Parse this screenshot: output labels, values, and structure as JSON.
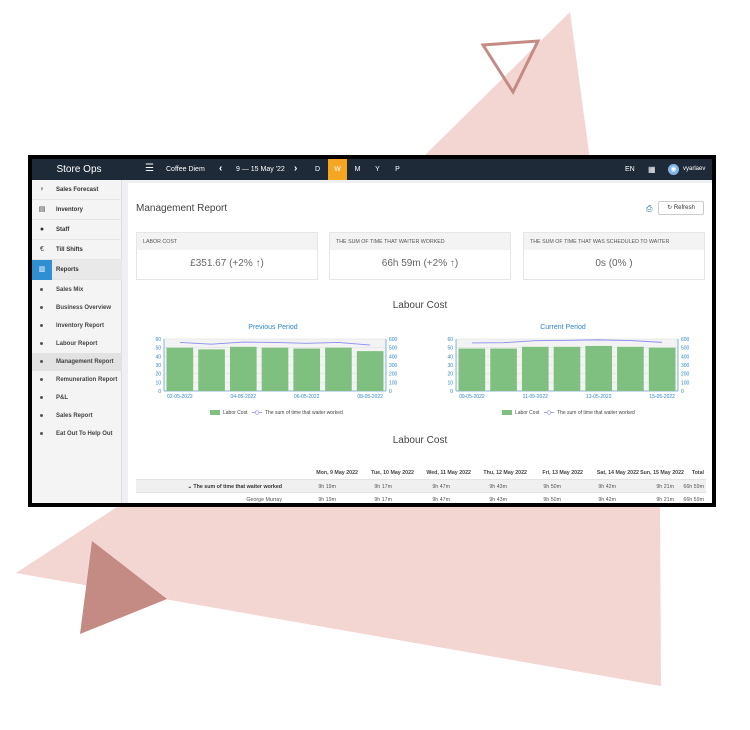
{
  "colors": {
    "triangle_light": "#f3d5d2",
    "triangle_dark": "#c48a84",
    "topbar": "#1f2a38",
    "accent": "#f5a623",
    "bar_green": "#7fbf7f",
    "line_purple": "#8c8cf0",
    "link_blue": "#2f86c9"
  },
  "topbar": {
    "brand": "Store Ops",
    "store": "Coffee Diem",
    "period": "9 — 15 May '22",
    "tabs": [
      "D",
      "W",
      "M",
      "Y",
      "P"
    ],
    "active_tab": "W",
    "language": "EN",
    "username": "vyarlaev"
  },
  "sidebar": {
    "items": [
      {
        "label": "Sales Forecast",
        "icon": "bulb-icon"
      },
      {
        "label": "Inventory",
        "icon": "box-icon"
      },
      {
        "label": "Staff",
        "icon": "person-icon"
      },
      {
        "label": "Till Shifts",
        "icon": "euro-icon"
      },
      {
        "label": "Reports",
        "icon": "bar-chart-icon",
        "active": true
      }
    ],
    "sub_items": [
      "Sales Mix",
      "Business Overview",
      "Inventory Report",
      "Labour Report",
      "Management Report",
      "Remuneration Report",
      "P&L",
      "Sales Report",
      "Eat Out To Help Out"
    ],
    "active_sub": "Management Report"
  },
  "content": {
    "title": "Management Report",
    "refresh_label": "Refresh",
    "stats": [
      {
        "label": "LABOR COST",
        "value": "£351.67 (+2% ↑)"
      },
      {
        "label": "THE SUM OF TIME THAT WAITER WORKED",
        "value": "66h 59m (+2% ↑)"
      },
      {
        "label": "THE SUM OF TIME THAT WAS SCHEDULED TO WAITER",
        "value": "0s (0% )"
      }
    ],
    "section1_title": "Labour Cost",
    "section2_title": "Labour Cost"
  },
  "chart_data": [
    {
      "type": "bar",
      "title": "Previous Period",
      "categories": [
        "02-05-2022",
        "03-05-2022",
        "04-05-2022",
        "05-05-2022",
        "06-05-2022",
        "07-05-2022",
        "08-05-2022"
      ],
      "x_tick_labels": [
        "02-05-2022",
        "04-05-2022",
        "06-05-2022",
        "08-05-2022"
      ],
      "series": [
        {
          "name": "Labor Cost",
          "type": "bar",
          "axis": "left",
          "values": [
            50,
            48,
            51,
            50,
            49,
            50,
            46
          ]
        },
        {
          "name": "The sum of time that waiter worked",
          "type": "line",
          "axis": "right",
          "values": [
            560,
            540,
            565,
            560,
            550,
            560,
            530
          ]
        }
      ],
      "ylim_left": [
        0,
        60
      ],
      "yticks_left": [
        0,
        10,
        20,
        30,
        40,
        50,
        60
      ],
      "ylim_right": [
        0,
        600
      ],
      "yticks_right": [
        0,
        100,
        200,
        300,
        400,
        500,
        600
      ],
      "legend": "bottom"
    },
    {
      "type": "bar",
      "title": "Current Period",
      "categories": [
        "09-05-2022",
        "10-05-2022",
        "11-05-2022",
        "12-05-2022",
        "13-05-2022",
        "14-05-2022",
        "15-05-2022"
      ],
      "x_tick_labels": [
        "09-05-2022",
        "11-05-2022",
        "13-05-2022",
        "15-05-2022"
      ],
      "series": [
        {
          "name": "Labor Cost",
          "type": "bar",
          "axis": "left",
          "values": [
            49,
            49,
            51,
            51,
            52,
            51,
            50
          ]
        },
        {
          "name": "The sum of time that waiter worked",
          "type": "line",
          "axis": "right",
          "values": [
            555,
            557,
            580,
            585,
            590,
            582,
            561
          ]
        }
      ],
      "ylim_left": [
        0,
        60
      ],
      "yticks_left": [
        0,
        10,
        20,
        30,
        40,
        50,
        60
      ],
      "ylim_right": [
        0,
        600
      ],
      "yticks_right": [
        0,
        100,
        200,
        300,
        400,
        500,
        600
      ],
      "legend": "bottom"
    }
  ],
  "table": {
    "headers": [
      "Mon, 9 May 2022",
      "Tue, 10 May 2022",
      "Wed, 11 May 2022",
      "Thu, 12 May 2022",
      "Fri, 13 May 2022",
      "Sat, 14 May 2022",
      "Sun, 15 May 2022",
      "Total"
    ],
    "rows": [
      {
        "label": "The sum of time that waiter worked",
        "group": true,
        "cells": [
          "9h 19m",
          "9h 17m",
          "9h 47m",
          "9h 43m",
          "9h 50m",
          "9h 42m",
          "9h 21m",
          "66h 59m"
        ]
      },
      {
        "label": "George Murray",
        "group": false,
        "cells": [
          "9h 19m",
          "9h 17m",
          "9h 47m",
          "9h 43m",
          "9h 50m",
          "9h 42m",
          "9h 21m",
          "66h 59m"
        ]
      }
    ]
  }
}
